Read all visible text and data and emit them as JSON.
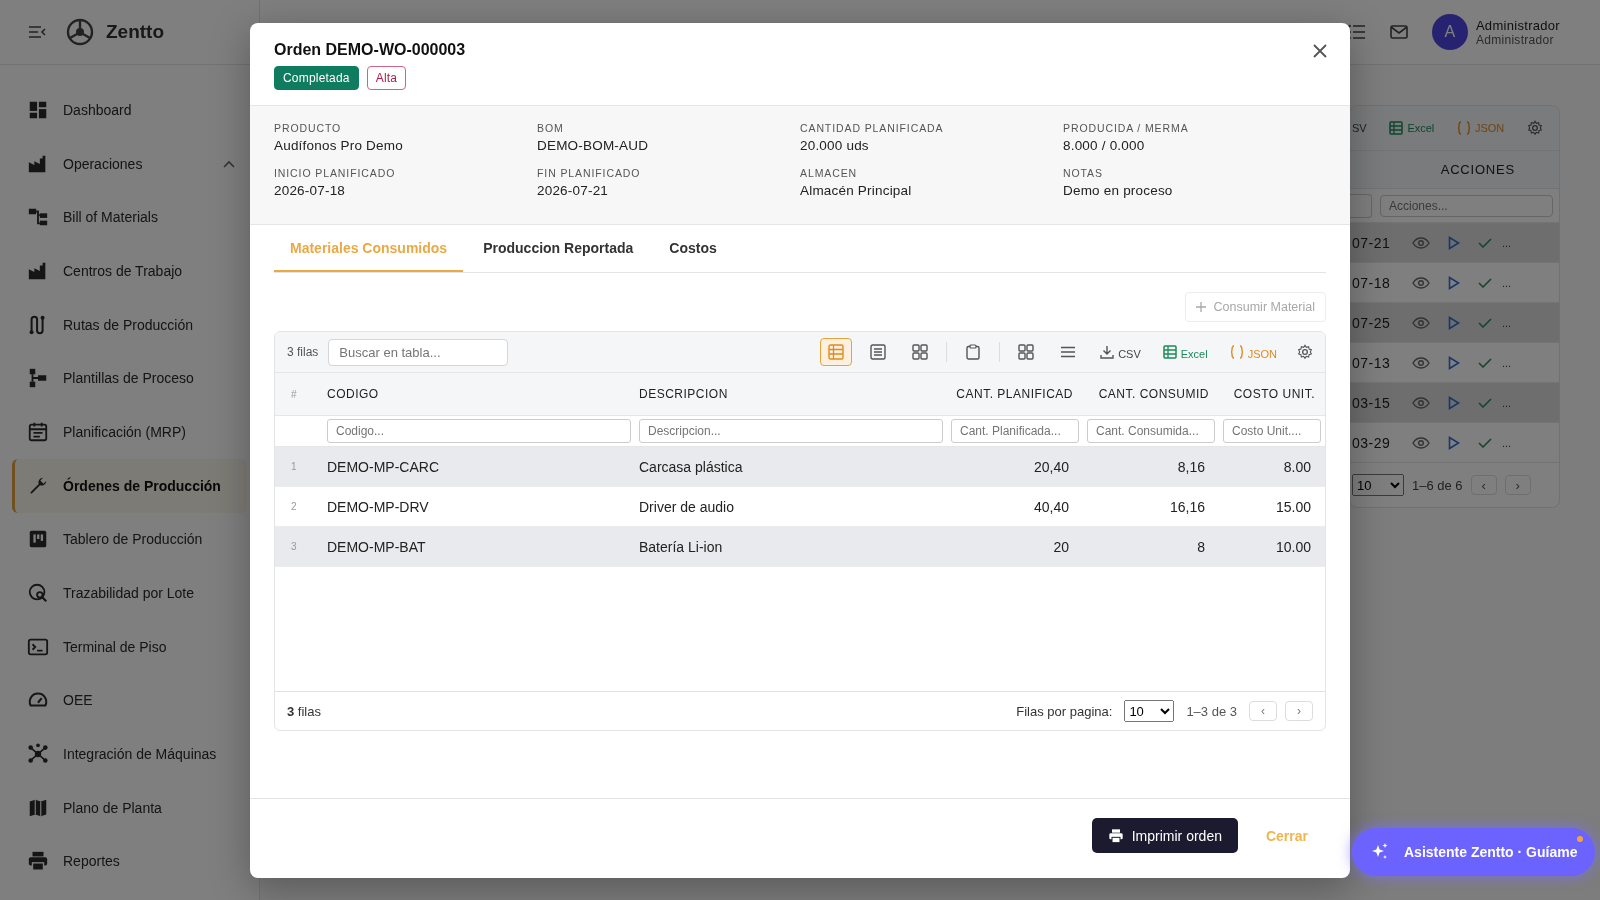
{
  "app": {
    "brand": "Zentto"
  },
  "sidebar": {
    "items": [
      {
        "label": "Dashboard",
        "selected": false
      },
      {
        "label": "Operaciones",
        "selected": false,
        "expanded": true
      },
      {
        "label": "Bill of Materials",
        "selected": false
      },
      {
        "label": "Centros de Trabajo",
        "selected": false
      },
      {
        "label": "Rutas de Producción",
        "selected": false
      },
      {
        "label": "Plantillas de Proceso",
        "selected": false
      },
      {
        "label": "Planificación (MRP)",
        "selected": false
      },
      {
        "label": "Órdenes de Producción",
        "selected": true
      },
      {
        "label": "Tablero de Producción",
        "selected": false
      },
      {
        "label": "Trazabilidad por Lote",
        "selected": false
      },
      {
        "label": "Terminal de Piso",
        "selected": false
      },
      {
        "label": "OEE",
        "selected": false
      },
      {
        "label": "Integración de Máquinas",
        "selected": false
      },
      {
        "label": "Plano de Planta",
        "selected": false
      },
      {
        "label": "Reportes",
        "selected": false
      }
    ]
  },
  "topbar": {
    "user": {
      "initial": "A",
      "name": "Administrador",
      "role": "Administrador"
    }
  },
  "background_table": {
    "exports": [
      {
        "label": "SV",
        "kind": "csv"
      },
      {
        "label": "Excel",
        "kind": "excel"
      },
      {
        "label": "JSON",
        "kind": "json"
      }
    ],
    "column": "ACCIONES",
    "filter": {
      "placeholder": "Acciones..."
    },
    "rows": [
      {
        "date": "07-21",
        "more": "..."
      },
      {
        "date": "07-18",
        "more": "..."
      },
      {
        "date": "07-25",
        "more": "..."
      },
      {
        "date": "07-13",
        "more": "..."
      },
      {
        "date": "03-15",
        "more": "..."
      },
      {
        "date": "03-29",
        "more": "..."
      }
    ],
    "pagination": {
      "page_size": "10",
      "range": "1–6 de 6",
      "prev": "‹",
      "next": "›"
    }
  },
  "modal": {
    "title": "Orden DEMO-WO-000003",
    "badges": [
      {
        "label": "Completada",
        "kind": "status"
      },
      {
        "label": "Alta",
        "kind": "priority"
      }
    ],
    "details": [
      {
        "label": "PRODUCTO",
        "value": "Audífonos Pro Demo"
      },
      {
        "label": "BOM",
        "value": "DEMO-BOM-AUD"
      },
      {
        "label": "CANTIDAD PLANIFICADA",
        "value": "20.000 uds"
      },
      {
        "label": "PRODUCIDA / MERMA",
        "value": "8.000 / 0.000"
      },
      {
        "label": "INICIO PLANIFICADO",
        "value": "2026-07-18"
      },
      {
        "label": "FIN PLANIFICADO",
        "value": "2026-07-21"
      },
      {
        "label": "ALMACEN",
        "value": "Almacén Principal"
      },
      {
        "label": "NOTAS",
        "value": "Demo en proceso"
      }
    ],
    "tabs": [
      {
        "label": "Materiales Consumidos",
        "selected": true
      },
      {
        "label": "Produccion Reportada",
        "selected": false
      },
      {
        "label": "Costos",
        "selected": false
      }
    ],
    "action": {
      "label": "Consumir Material",
      "disabled": true
    },
    "grid": {
      "count": "3 filas",
      "search_placeholder": "Buscar en tabla...",
      "view_modes": [
        {
          "selected": true
        },
        {
          "selected": false
        },
        {
          "selected": false
        }
      ],
      "exports": [
        {
          "label": "CSV",
          "kind": "csv"
        },
        {
          "label": "Excel",
          "kind": "excel"
        },
        {
          "label": "JSON",
          "kind": "json"
        }
      ],
      "columns": [
        {
          "label": "#"
        },
        {
          "label": "CODIGO",
          "placeholder": "Codigo..."
        },
        {
          "label": "DESCRIPCION",
          "placeholder": "Descripcion..."
        },
        {
          "label": "CANT. PLANIFICAD",
          "placeholder": "Cant. Planificada..."
        },
        {
          "label": "CANT. CONSUMID",
          "placeholder": "Cant. Consumida..."
        },
        {
          "label": "COSTO UNIT.",
          "placeholder": "Costo Unit...."
        }
      ],
      "rows": [
        {
          "num": "1",
          "code": "DEMO-MP-CARC",
          "description": "Carcasa plástica",
          "planned": "20,40",
          "consumed": "8,16",
          "unit_cost": "8.00"
        },
        {
          "num": "2",
          "code": "DEMO-MP-DRV",
          "description": "Driver de audio",
          "planned": "40,40",
          "consumed": "16,16",
          "unit_cost": "15.00"
        },
        {
          "num": "3",
          "code": "DEMO-MP-BAT",
          "description": "Batería Li-ion",
          "planned": "20",
          "consumed": "8",
          "unit_cost": "10.00"
        }
      ],
      "footer": {
        "count": "**3** filas",
        "rows_per_page_label": "Filas por pagina:",
        "page_size": "10",
        "range": "1–3 de 3",
        "prev": "‹",
        "next": "›"
      }
    },
    "buttons": [
      {
        "label": "Imprimir orden",
        "kind": "primary"
      },
      {
        "label": "Cerrar",
        "kind": "text"
      }
    ]
  },
  "assistant": {
    "label": "Asistente Zentto · Guíame",
    "notification": true
  }
}
